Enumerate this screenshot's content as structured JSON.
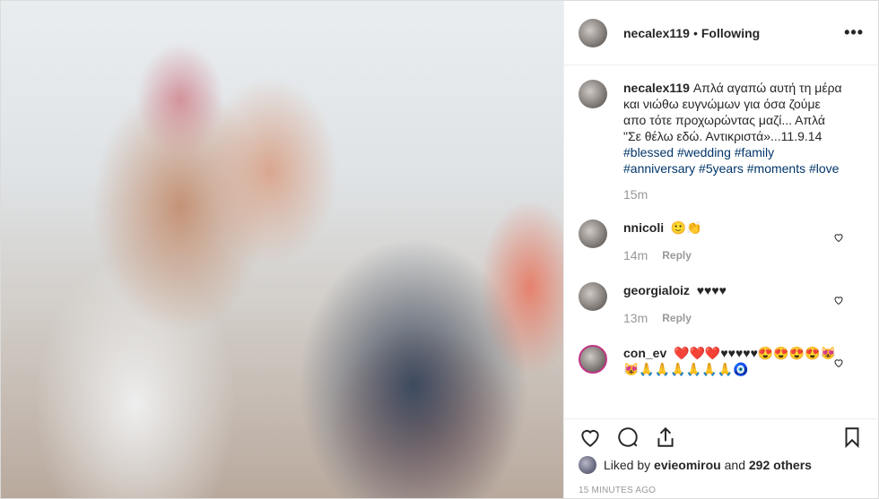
{
  "post": {
    "username": "necalex119",
    "separator": "•",
    "follow_status": "Following",
    "more_label": "•••"
  },
  "caption": {
    "username": "necalex119",
    "text": "Απλά αγαπώ αυτή τη μέρα και νιώθω ευγνώμων για όσα ζούμε απο τότε προχωρώντας μαζί... Απλά \"Σε θέλω εδώ. Αντικριστά»...11.9.14",
    "hashtags": [
      "#blessed",
      "#wedding",
      "#family",
      "#anniversary",
      "#5years",
      "#moments",
      "#love"
    ],
    "time": "15m"
  },
  "comments": [
    {
      "username": "nnicoli",
      "text": "🙂👏",
      "time": "14m",
      "reply": "Reply"
    },
    {
      "username": "georgialoiz",
      "text": "♥♥♥♥",
      "time": "13m",
      "reply": "Reply"
    },
    {
      "username": "con_ev",
      "text": "❤️❤️❤️♥♥♥♥♥😍😍😍😍😻😻🙏🙏🙏🙏🙏🙏🧿",
      "time": "",
      "reply": ""
    }
  ],
  "likes": {
    "prefix": "Liked by",
    "user": "evieomirou",
    "middle": "and",
    "others": "292 others"
  },
  "timestamp": "15 MINUTES AGO",
  "icons": [
    "heart-icon",
    "comment-icon",
    "share-icon",
    "bookmark-icon",
    "more-icon"
  ]
}
